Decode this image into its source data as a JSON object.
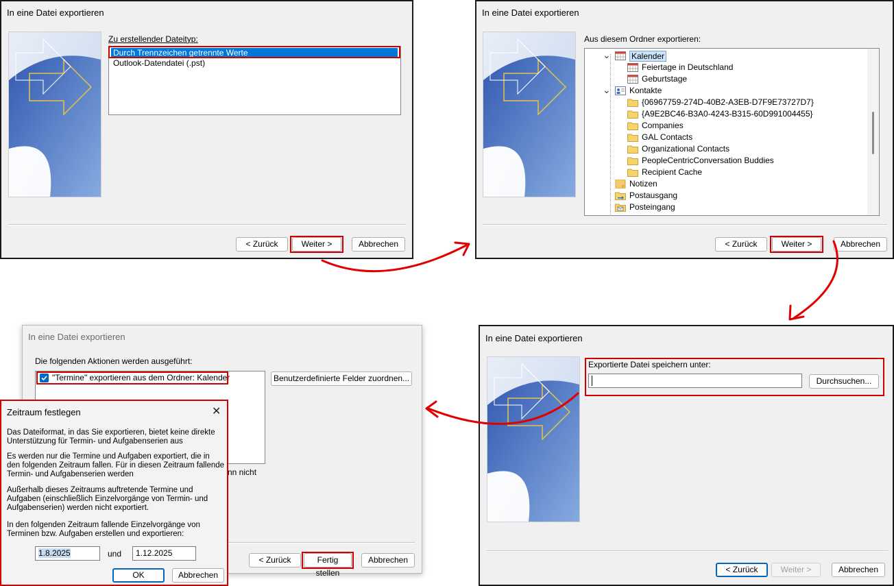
{
  "dialog_title": "In eine Datei exportieren",
  "step1": {
    "label": "Zu erstellender Dateityp:",
    "items": [
      "Durch Trennzeichen getrennte Werte",
      "Outlook-Datendatei (.pst)"
    ]
  },
  "step2": {
    "label": "Aus diesem Ordner exportieren:",
    "tree": [
      {
        "text": "Kalender",
        "icon": "calendar-icon",
        "level": 1,
        "expanded": true
      },
      {
        "text": "Feiertage in Deutschland",
        "icon": "calendar-icon",
        "level": 2
      },
      {
        "text": "Geburtstage",
        "icon": "calendar-icon",
        "level": 2
      },
      {
        "text": "Kontakte",
        "icon": "contact-card-icon",
        "level": 1,
        "expanded": true
      },
      {
        "text": "{06967759-274D-40B2-A3EB-D7F9E73727D7}",
        "icon": "folder-icon",
        "level": 2
      },
      {
        "text": "{A9E2BC46-B3A0-4243-B315-60D991004455}",
        "icon": "folder-icon",
        "level": 2
      },
      {
        "text": "Companies",
        "icon": "folder-icon",
        "level": 2
      },
      {
        "text": "GAL Contacts",
        "icon": "folder-icon",
        "level": 2
      },
      {
        "text": "Organizational Contacts",
        "icon": "folder-icon",
        "level": 2
      },
      {
        "text": "PeopleCentricConversation Buddies",
        "icon": "folder-icon",
        "level": 2
      },
      {
        "text": "Recipient Cache",
        "icon": "folder-icon",
        "level": 2
      },
      {
        "text": "Notizen",
        "icon": "notes-icon",
        "level": 1
      },
      {
        "text": "Postausgang",
        "icon": "outbox-icon",
        "level": 1
      },
      {
        "text": "Posteingang",
        "icon": "inbox-icon",
        "level": 1
      }
    ]
  },
  "step3": {
    "label": "Exportierte Datei speichern unter:",
    "path_value": "",
    "browse": "Durchsuchen..."
  },
  "step4": {
    "label": "Die folgenden Aktionen werden ausgeführt:",
    "action": "\"Termine\" exportieren aus dem Ordner: Kalender",
    "map_fields": "Benutzerdefinierte Felder zuordnen...",
    "partial_text": "nn nicht",
    "finish": "Fertig stellen"
  },
  "range_dialog": {
    "title": "Zeitraum festlegen",
    "p1": "Das Dateiformat, in das Sie exportieren, bietet keine direkte Unterstützung für Termin- und Aufgabenserien aus",
    "p2": "Es werden nur die Termine und Aufgaben exportiert, die in den folgenden Zeitraum fallen. Für in diesen Zeitraum fallende Termin- und Aufgabenserien werden",
    "p3": "Außerhalb dieses Zeitraums auftretende Termine und Aufgaben (einschließlich Einzelvorgänge von Termin- und Aufgabenserien) werden nicht exportiert.",
    "p4": "In den folgenden Zeitraum fallende Einzelvorgänge von Terminen bzw. Aufgaben erstellen und exportieren:",
    "from": "1.8.2025",
    "and": "und",
    "to": "1.12.2025",
    "ok": "OK",
    "cancel": "Abbrechen"
  },
  "buttons": {
    "back": "< Zurück",
    "next": "Weiter >",
    "cancel": "Abbrechen"
  },
  "colors": {
    "highlight": "#d00000",
    "selection": "#0078d7",
    "arrow": "#e00000"
  }
}
